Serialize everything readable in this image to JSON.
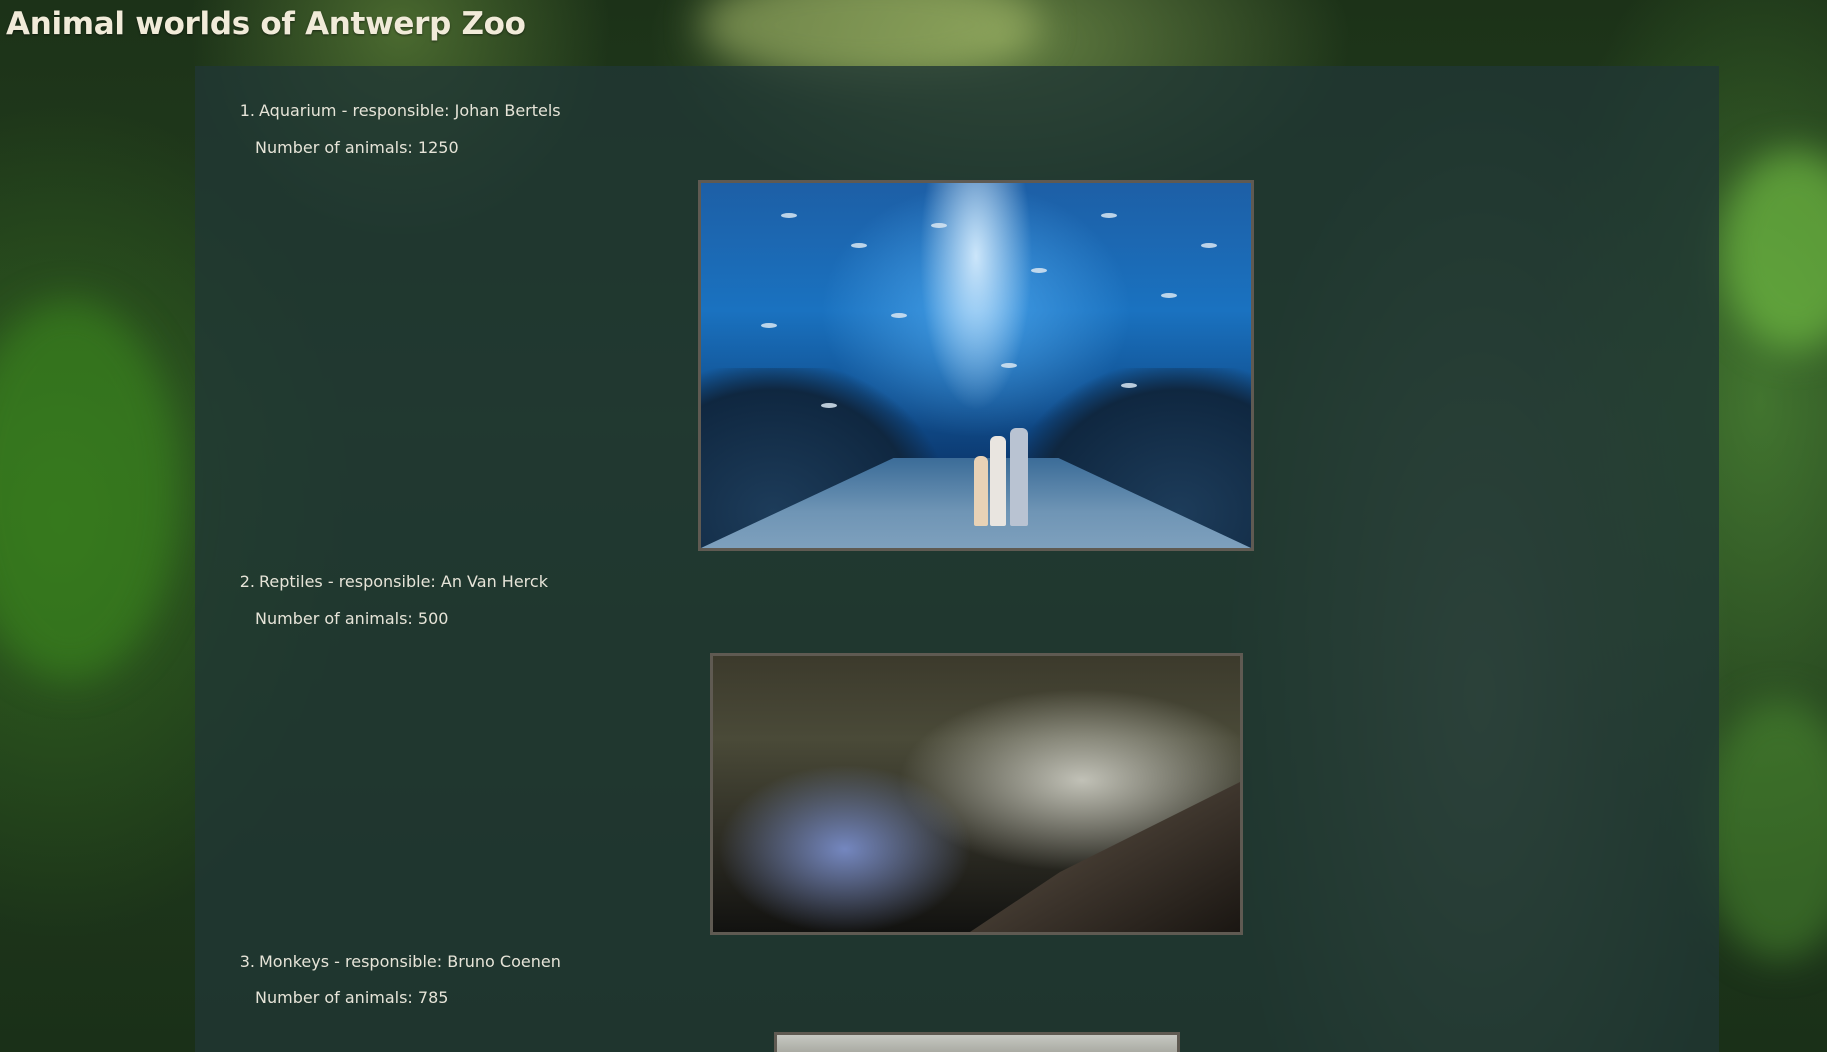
{
  "page": {
    "title": "Animal worlds of Antwerp Zoo"
  },
  "worlds": [
    {
      "number": "1.",
      "heading": "Aquarium - responsible: Johan Bertels",
      "count_text": "Number of animals: 1250",
      "image_label": "aquarium-photo"
    },
    {
      "number": "2.",
      "heading": "Reptiles - responsible: An Van Herck",
      "count_text": "Number of animals: 500",
      "image_label": "reptiles-photo"
    },
    {
      "number": "3.",
      "heading": "Monkeys - responsible: Bruno Coenen",
      "count_text": "Number of animals: 785",
      "image_label": "monkeys-photo"
    }
  ]
}
